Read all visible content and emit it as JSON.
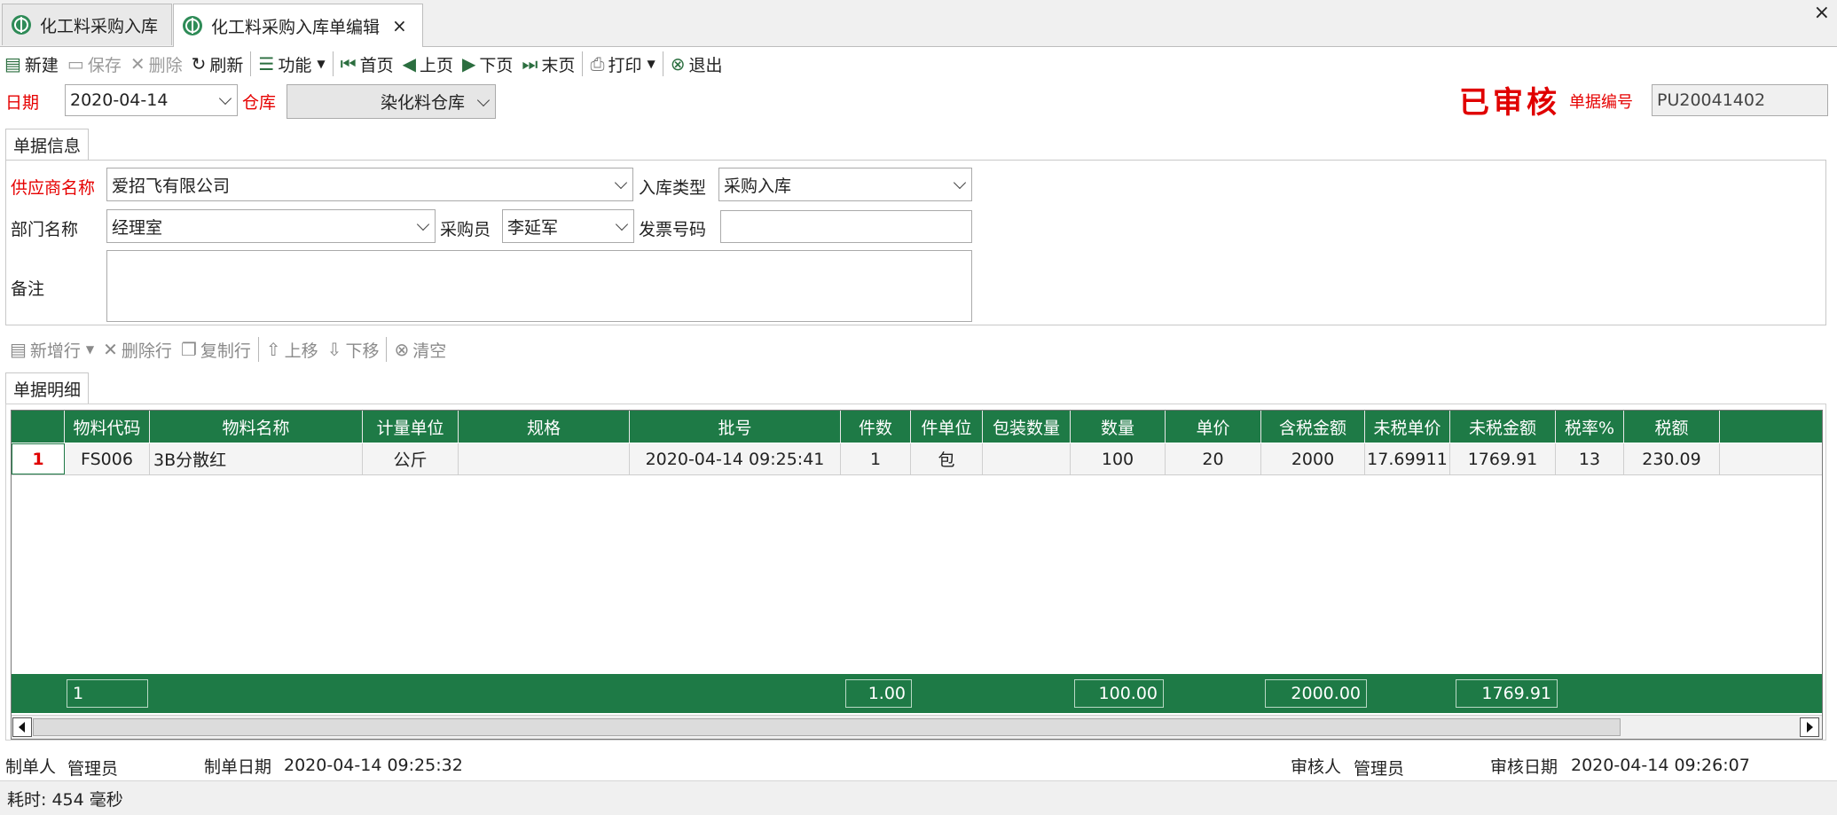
{
  "tabs": [
    {
      "label": "化工料采购入库"
    },
    {
      "label": "化工料采购入库单编辑"
    }
  ],
  "window_close": "×",
  "tab_close": "×",
  "toolbar": {
    "new": "新建",
    "save": "保存",
    "delete": "删除",
    "refresh": "刷新",
    "function": "功能",
    "first": "首页",
    "prev": "上页",
    "next": "下页",
    "last": "末页",
    "print": "打印",
    "exit": "退出"
  },
  "header": {
    "date_label": "日期",
    "date_value": "2020-04-14",
    "warehouse_label": "仓库",
    "warehouse_value": "染化料仓库",
    "status_stamp": "已审核",
    "doc_no_label": "单据编号",
    "doc_no_value": "PU20041402"
  },
  "info": {
    "tab_label": "单据信息",
    "supplier_label": "供应商名称",
    "supplier_value": "爱招飞有限公司",
    "in_type_label": "入库类型",
    "in_type_value": "采购入库",
    "dept_label": "部门名称",
    "dept_value": "经理室",
    "buyer_label": "采购员",
    "buyer_value": "李延军",
    "invoice_label": "发票号码",
    "invoice_value": "",
    "remark_label": "备注",
    "remark_value": ""
  },
  "row_toolbar": {
    "add_row": "新增行",
    "delete_row": "删除行",
    "copy_row": "复制行",
    "move_up": "上移",
    "move_down": "下移",
    "clear": "清空"
  },
  "detail": {
    "tab_label": "单据明细",
    "columns": [
      "物料代码",
      "物料名称",
      "计量单位",
      "规格",
      "批号",
      "件数",
      "件单位",
      "包装数量",
      "数量",
      "单价",
      "含税金额",
      "未税单价",
      "未税金额",
      "税率%",
      "税额"
    ],
    "rows": [
      {
        "index": "1",
        "code": "FS006",
        "name": "3B分散红",
        "unit": "公斤",
        "spec": "",
        "batch": "2020-04-14 09:25:41",
        "pieces": "1",
        "piece_unit": "包",
        "pack_qty": "",
        "qty": "100",
        "price": "20",
        "tax_amount": "2000",
        "net_price": "17.69911",
        "net_amount": "1769.91",
        "tax_rate": "13",
        "tax": "230.09"
      }
    ],
    "footer": {
      "count": "1",
      "pieces": "1.00",
      "qty": "100.00",
      "tax_amount": "2000.00",
      "net_amount": "1769.91"
    }
  },
  "bottom": {
    "maker_label": "制单人",
    "maker_value": "管理员",
    "make_date_label": "制单日期",
    "make_date_value": "2020-04-14 09:25:32",
    "auditor_label": "审核人",
    "auditor_value": "管理员",
    "audit_date_label": "审核日期",
    "audit_date_value": "2020-04-14 09:26:07"
  },
  "status_bar": "耗时: 454 毫秒",
  "colors": {
    "accent": "#1e7a46",
    "required_label": "#e60000",
    "stamp": "#e00000"
  }
}
